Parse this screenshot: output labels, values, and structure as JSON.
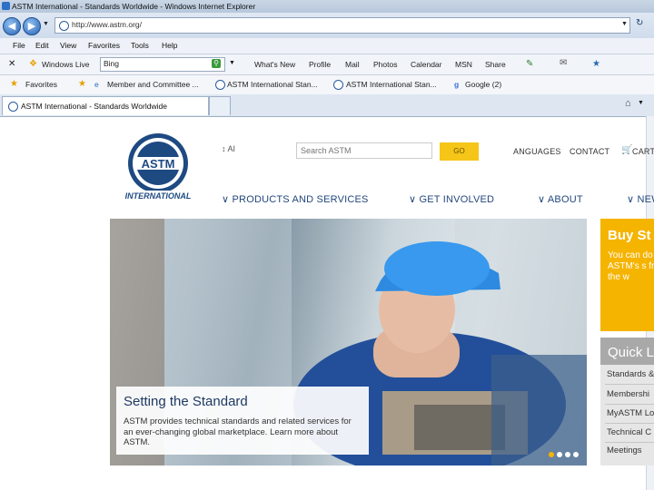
{
  "window": {
    "title": "ASTM International - Standards Worldwide - Windows Internet Explorer"
  },
  "address": {
    "url": "http://www.astm.org/"
  },
  "menu": [
    "File",
    "Edit",
    "View",
    "Favorites",
    "Tools",
    "Help"
  ],
  "windows_live": {
    "label": "Windows Live",
    "search_value": "Bing",
    "items": [
      "What's New",
      "Profile",
      "Mail",
      "Photos",
      "Calendar",
      "MSN",
      "Share"
    ]
  },
  "favorites_bar": {
    "label": "Favorites",
    "items": [
      "Member and Committee ...",
      "ASTM International Stan...",
      "ASTM International Stan...",
      "Google (2)"
    ]
  },
  "tab": {
    "title": "ASTM International - Standards Worldwide"
  },
  "site": {
    "logo_text": "INTERNATIONAL",
    "lang_select": "↕ AI",
    "search_placeholder": "Search ASTM",
    "go_label": "GO",
    "top_links": [
      "ANGUAGES",
      "CONTACT",
      "CART"
    ],
    "nav": [
      "∨ PRODUCTS AND SERVICES",
      "∨ GET INVOLVED",
      "∨ ABOUT",
      "∨ NEW"
    ],
    "hero": {
      "title": "Setting the Standard",
      "text": "ASTM provides technical standards and related services for an ever-changing global marketplace. Learn more about ASTM."
    },
    "buy_panel": {
      "title": "Buy St",
      "text": "You can do of ASTM's s from the w"
    },
    "quick_panel": {
      "title": "Quick L",
      "links": [
        "Standards &",
        "Membershi",
        "MyASTM Lo",
        "Technical C",
        "Meetings"
      ]
    }
  },
  "colors": {
    "accent_yellow": "#f5b400",
    "nav_blue": "#23477d",
    "panel_gray": "#a9a9a9"
  }
}
